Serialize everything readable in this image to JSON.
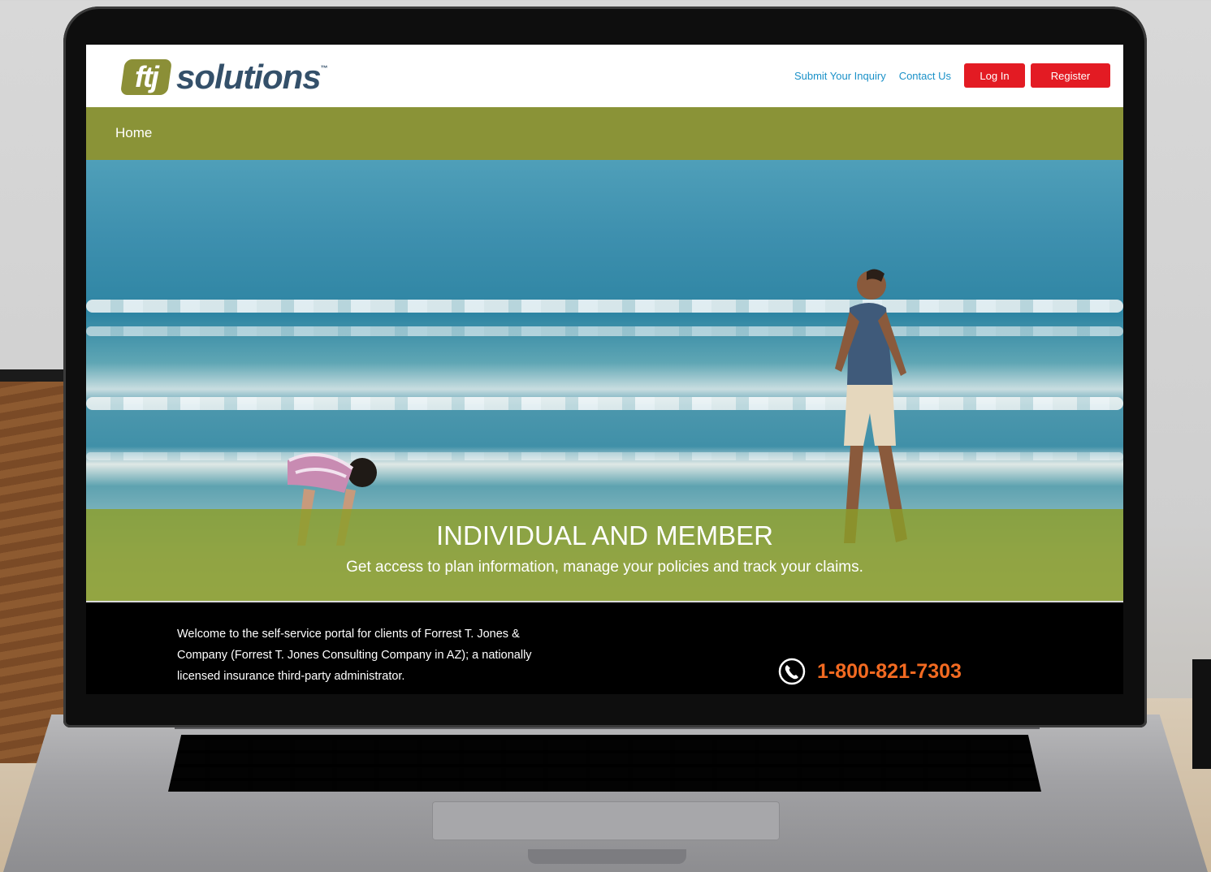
{
  "header": {
    "logo_mark": "ftj",
    "logo_word": "solutions",
    "logo_tm": "™",
    "nav": {
      "inquiry": "Submit Your Inquiry",
      "contact": "Contact Us",
      "login": "Log In",
      "register": "Register"
    }
  },
  "menubar": {
    "home": "Home"
  },
  "hero": {
    "title": "INDIVIDUAL AND MEMBER",
    "subtitle": "Get access to plan information, manage your policies and track your claims."
  },
  "footer": {
    "welcome": "Welcome to the self-service portal for clients of Forrest T. Jones & Company (Forrest T. Jones Consulting Company in AZ); a nationally licensed insurance third-party administrator.",
    "phone": "1-800-821-7303",
    "phone_icon": "phone-icon"
  },
  "colors": {
    "brand_green": "#8a9337",
    "brand_blue": "#34506a",
    "link_blue": "#1a91c8",
    "button_red": "#e31b23",
    "phone_orange": "#f26a21"
  }
}
